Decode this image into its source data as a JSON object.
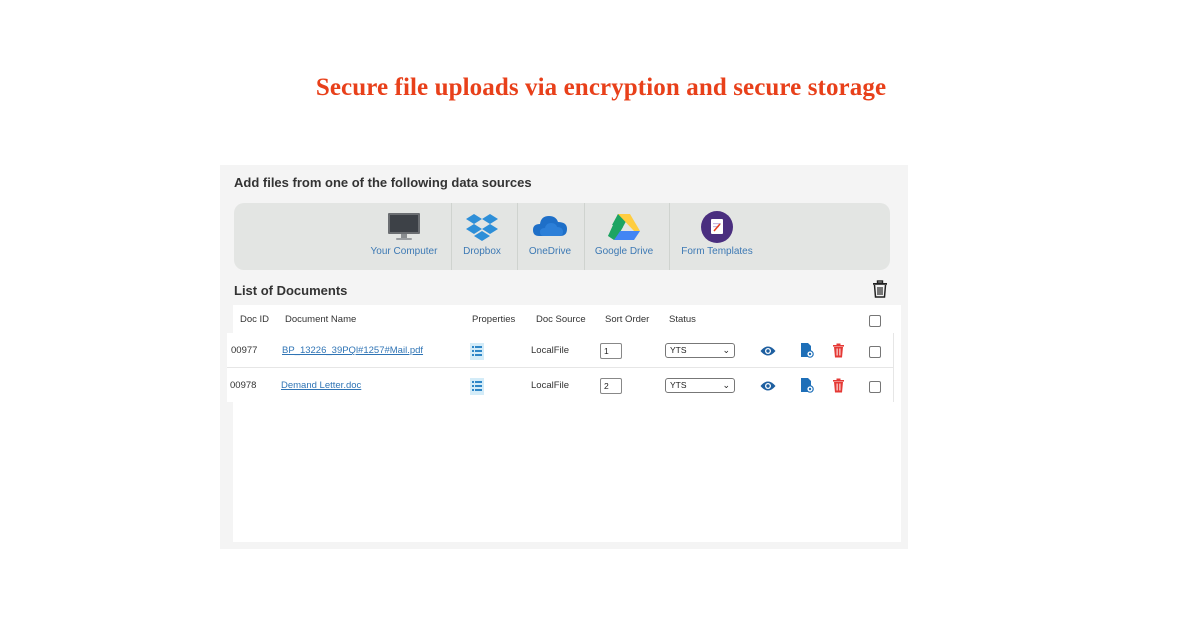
{
  "headline": "Secure file uploads via encryption and secure storage",
  "panel_title": "Add files from one of the following data sources",
  "sources": [
    {
      "label": "Your Computer",
      "icon": "computer-icon"
    },
    {
      "label": "Dropbox",
      "icon": "dropbox-icon"
    },
    {
      "label": "OneDrive",
      "icon": "onedrive-icon"
    },
    {
      "label": "Google Drive",
      "icon": "google-drive-icon"
    },
    {
      "label": "Form Templates",
      "icon": "form-templates-icon"
    }
  ],
  "list_title": "List of Documents",
  "columns": {
    "doc_id": "Doc ID",
    "document_name": "Document Name",
    "properties": "Properties",
    "doc_source": "Doc Source",
    "sort_order": "Sort Order",
    "status": "Status"
  },
  "documents": [
    {
      "doc_id": "00977",
      "name": "BP_13226_39PQl#1257#Mail.pdf",
      "source": "LocalFile",
      "sort_order": "1",
      "status": "YTS"
    },
    {
      "doc_id": "00978",
      "name": "Demand Letter.doc",
      "source": "LocalFile",
      "sort_order": "2",
      "status": "YTS"
    }
  ],
  "colors": {
    "headline": "#e8401a",
    "link": "#2f74b5",
    "delete": "#e53935",
    "view": "#1e5fa0"
  }
}
